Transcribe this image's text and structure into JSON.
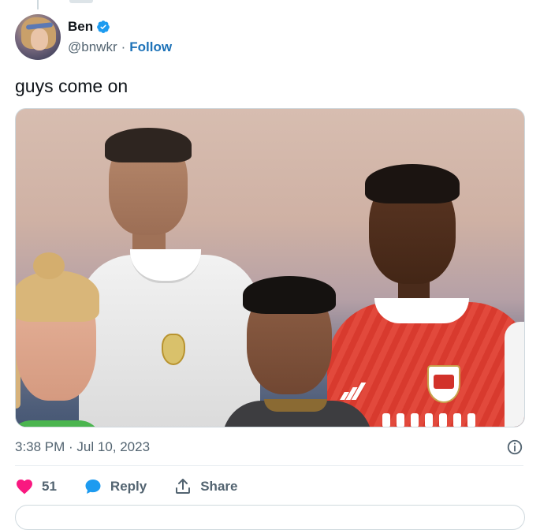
{
  "tweet": {
    "author": {
      "name": "Ben",
      "handle": "@bnwkr",
      "separator": "·",
      "follow_label": "Follow",
      "verified": true
    },
    "text": "guys come on",
    "timestamp": "3:38 PM · Jul 10, 2023",
    "actions": {
      "like_count": "51",
      "reply_label": "Reply",
      "share_label": "Share"
    }
  },
  "colors": {
    "accent": "#1d72b8",
    "verified": "#1d9bf0",
    "heart": "#f91880",
    "reply_icon": "#1d9bf0",
    "muted": "#536471"
  },
  "icons": [
    "verified-badge-icon",
    "info-icon",
    "heart-icon",
    "reply-bubble-icon",
    "share-icon"
  ]
}
